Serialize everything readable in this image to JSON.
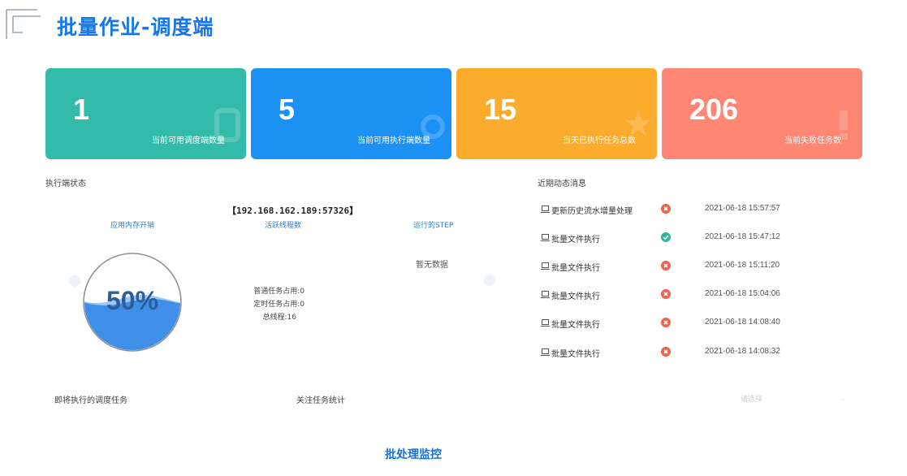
{
  "header": {
    "title": "批量作业-调度端",
    "logo_icon": "bracket-logo-icon"
  },
  "cards": [
    {
      "value": "1",
      "label": "当前可用调度端数量",
      "color": "#33bba9",
      "icon": "link-icon"
    },
    {
      "value": "5",
      "label": "当前可用执行端数量",
      "color": "#1c91f4",
      "icon": "refresh-icon"
    },
    {
      "value": "15",
      "label": "当天已执行任务总数",
      "color": "#fbac2c",
      "icon": "star-icon"
    },
    {
      "value": "206",
      "label": "当前失败任务数",
      "color": "#fe8672",
      "icon": "alert-icon"
    }
  ],
  "executor": {
    "title": "执行端状态",
    "address": "【192.168.162.189:57326】",
    "tabs": [
      "应用内存开销",
      "活跃线程数",
      "运行的STEP"
    ],
    "gauge_value": "50%",
    "gauge_percent": 50,
    "stats": [
      "普通任务占用:0",
      "定时任务占用:0",
      "总线程:16"
    ],
    "no_data": "暂无数据"
  },
  "messages": {
    "title": "近期动态消息",
    "items": [
      {
        "name": "更新历史流水增量处理",
        "status": "fail",
        "time": "2021-06-18 15:57:57"
      },
      {
        "name": "批量文件执行",
        "status": "ok",
        "time": "2021-06-18 15:47:12"
      },
      {
        "name": "批量文件执行",
        "status": "fail",
        "time": "2021-06-18 15:11:20"
      },
      {
        "name": "批量文件执行",
        "status": "fail",
        "time": "2021-06-18 15:04:06"
      },
      {
        "name": "批量文件执行",
        "status": "fail",
        "time": "2021-06-18 14:08:40"
      },
      {
        "name": "批量文件执行",
        "status": "fail",
        "time": "2021-06-18 14:08:32"
      }
    ]
  },
  "bottom": {
    "upcoming_title": "即将执行的调度任务",
    "watch_title": "关注任务统计",
    "select_placeholder": "请选择"
  },
  "footer": {
    "title": "批处理监控"
  },
  "colors": {
    "accent": "#1677e8",
    "fail": "#f0614f",
    "ok": "#2db8a0"
  }
}
